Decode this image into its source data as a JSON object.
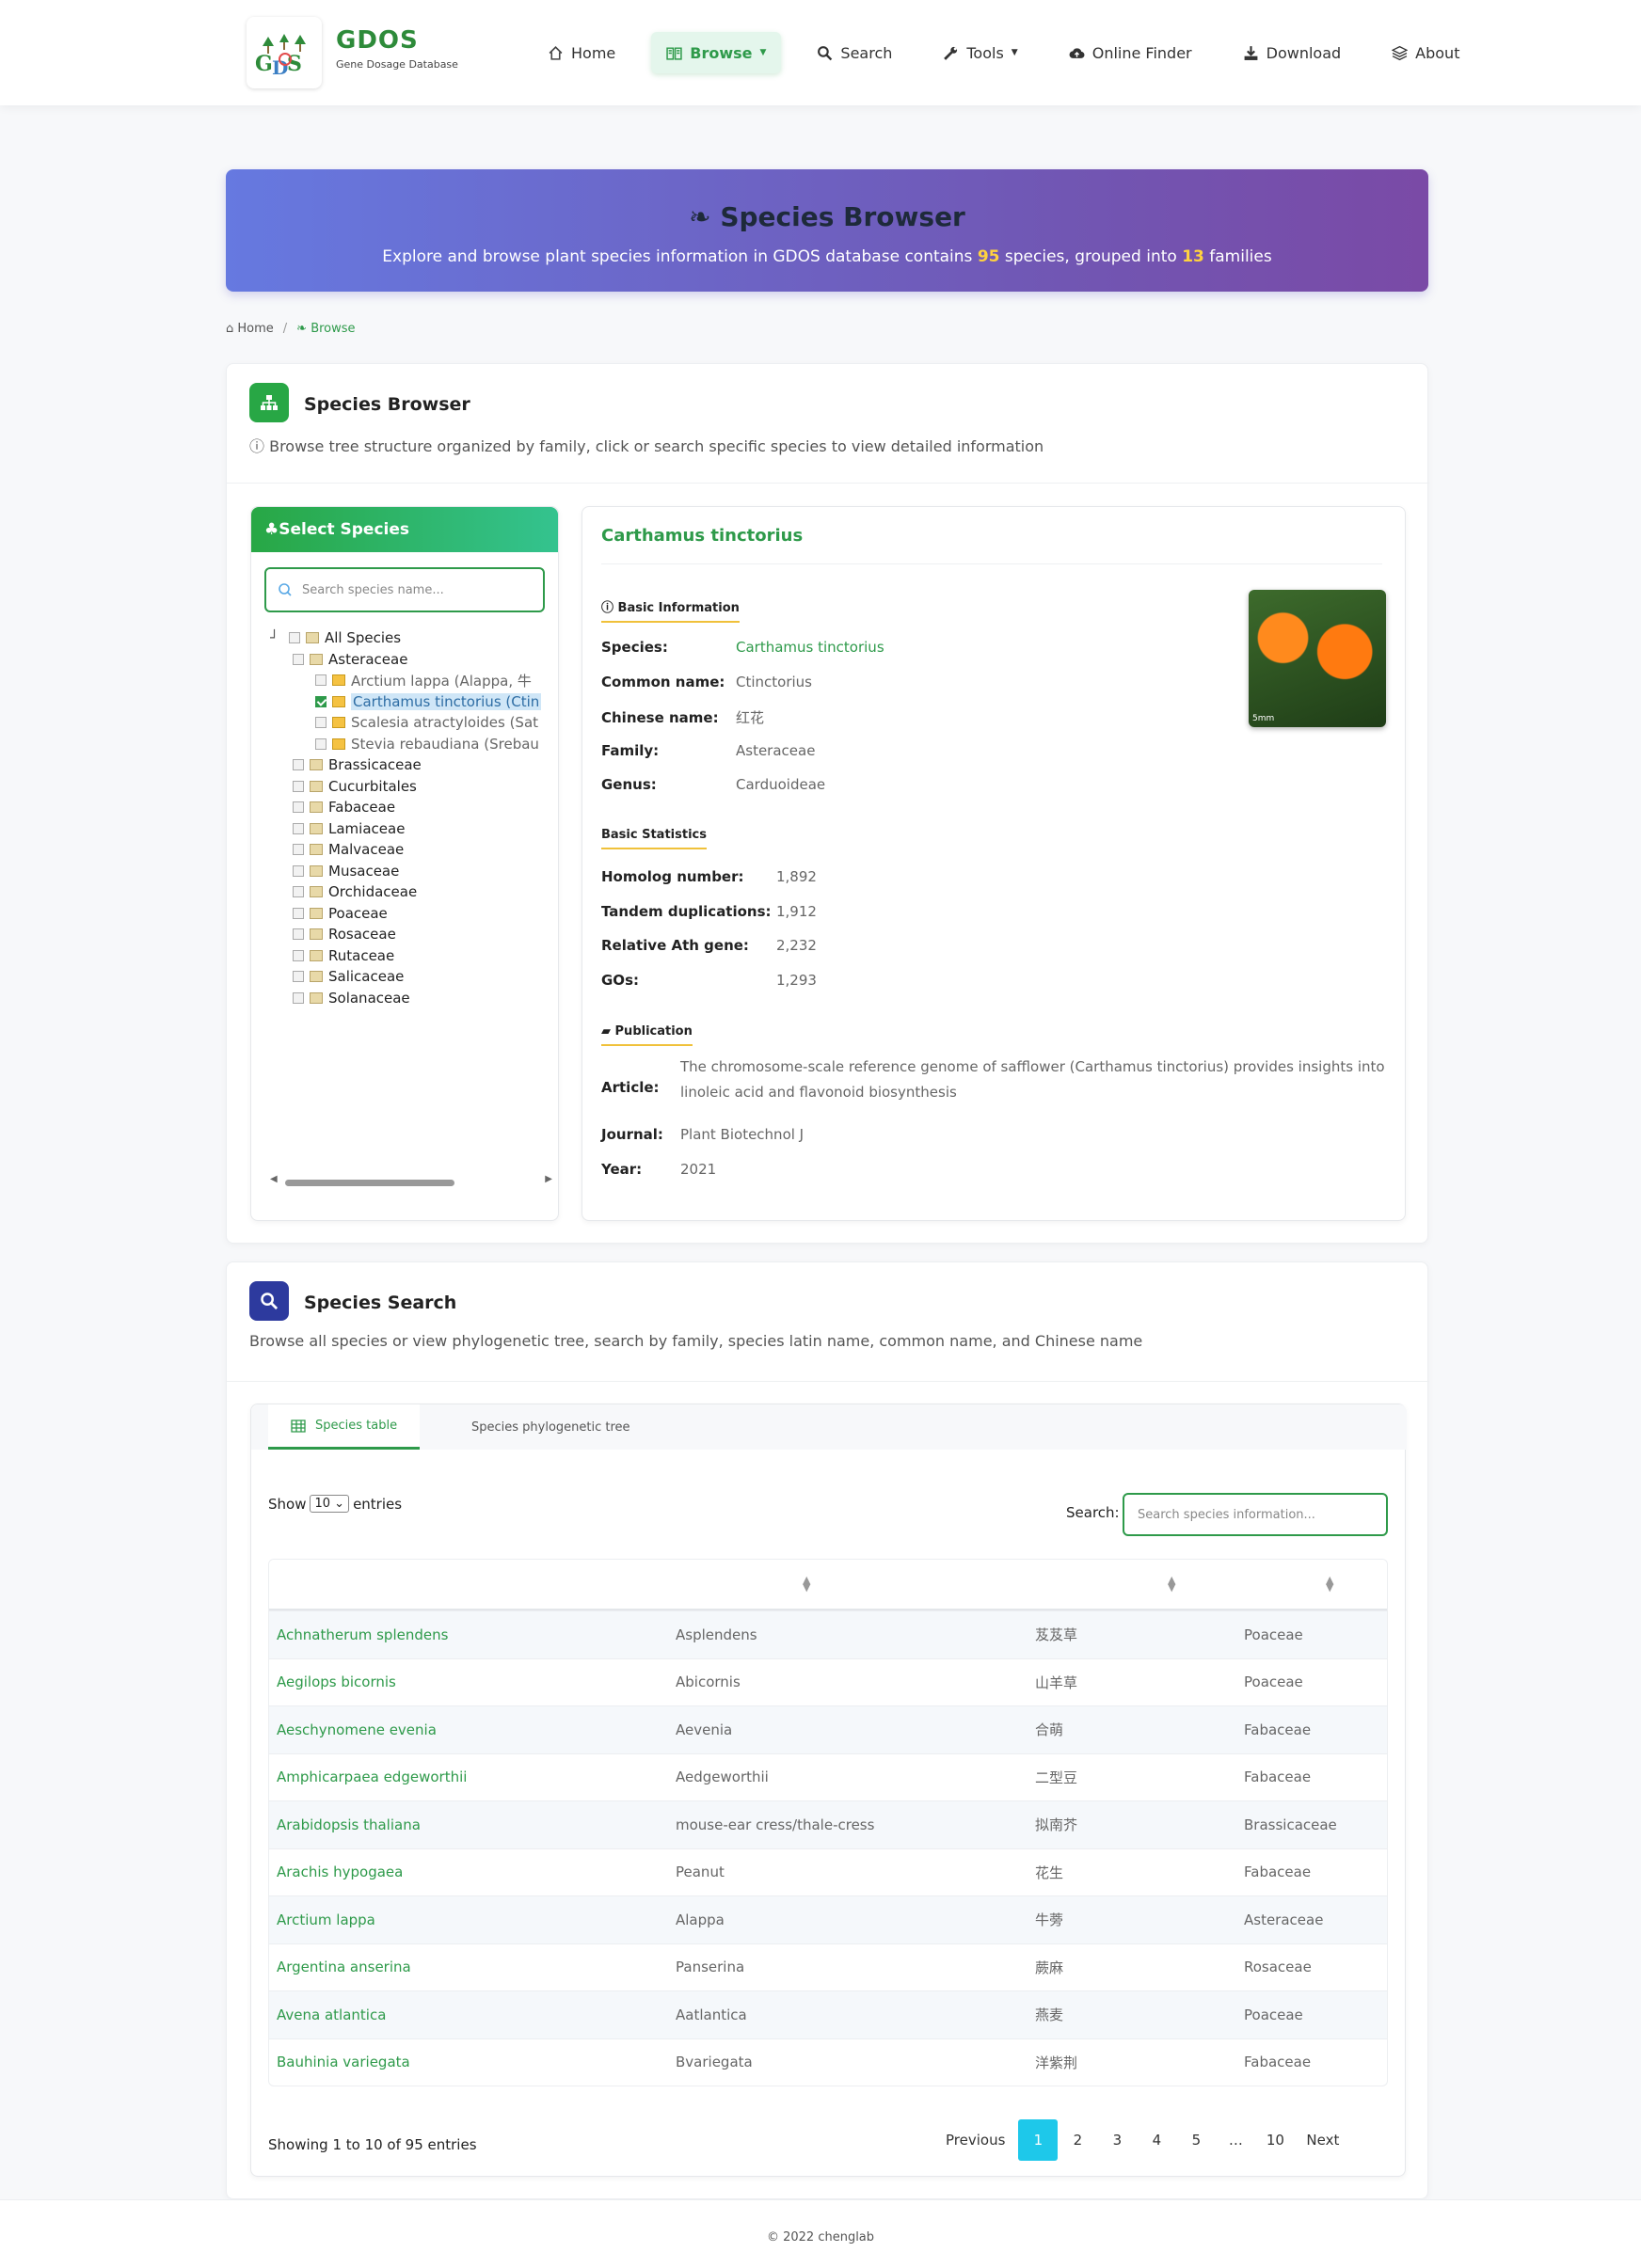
{
  "brand": {
    "name": "GDOS",
    "subtitle": "Gene Dosage Database"
  },
  "nav": [
    {
      "label": "Home",
      "icon": "home-icon"
    },
    {
      "label": "Browse",
      "icon": "book-icon",
      "active": true
    },
    {
      "label": "Search",
      "icon": "search-icon"
    },
    {
      "label": "Tools",
      "icon": "wrench-icon"
    },
    {
      "label": "Online Finder",
      "icon": "cloud-upload-icon"
    },
    {
      "label": "Download",
      "icon": "download-icon"
    },
    {
      "label": "About",
      "icon": "layers-icon"
    }
  ],
  "banner": {
    "title": "Species Browser",
    "text_pre": "Explore and browse plant species information in GDOS database contains ",
    "species_count": "95",
    "text_mid": " species, grouped into ",
    "family_count": "13",
    "text_post": " families"
  },
  "breadcrumb": {
    "home": "Home",
    "current": "Browse"
  },
  "browser": {
    "title": "Species Browser",
    "subtitle": "Browse tree structure organized by family, click or search specific species to view detailed information",
    "select_title": "Select Species",
    "search_placeholder": "Search species name...",
    "tree": {
      "root": "All Species",
      "expanded_family": "Asteraceae",
      "species": [
        {
          "label": "Arctium lappa (Alappa, 牛",
          "selected": false
        },
        {
          "label": "Carthamus tinctorius (Ctin",
          "selected": true
        },
        {
          "label": "Scalesia atractyloides (Sat",
          "selected": false
        },
        {
          "label": "Stevia rebaudiana (Srebau",
          "selected": false
        }
      ],
      "families": [
        "Brassicaceae",
        "Cucurbitales",
        "Fabaceae",
        "Lamiaceae",
        "Malvaceae",
        "Musaceae",
        "Orchidaceae",
        "Poaceae",
        "Rosaceae",
        "Rutaceae",
        "Salicaceae",
        "Solanaceae"
      ]
    }
  },
  "detail": {
    "title": "Carthamus tinctorius",
    "basic_label": "Basic Information",
    "basic": [
      {
        "k": "Species:",
        "v": "Carthamus tinctorius",
        "green": true
      },
      {
        "k": "Common name:",
        "v": "Ctinctorius"
      },
      {
        "k": "Chinese name:",
        "v": "红花"
      },
      {
        "k": "Family:",
        "v": "Asteraceae"
      },
      {
        "k": "Genus:",
        "v": "Carduoideae"
      }
    ],
    "stats_label": "Basic Statistics",
    "stats": [
      {
        "k": "Homolog number:",
        "v": "1,892"
      },
      {
        "k": "Tandem duplications:",
        "v": "1,912"
      },
      {
        "k": "Relative Ath gene:",
        "v": "2,232"
      },
      {
        "k": "GOs:",
        "v": "1,293"
      }
    ],
    "pub_label": "Publication",
    "article_k": "Article:",
    "article_v1": "The chromosome-scale reference genome of safflower (Carthamus tinctorius) provides insights into",
    "article_v2": "linoleic acid and flavonoid biosynthesis",
    "journal_k": "Journal:",
    "journal_v": "Plant Biotechnol J",
    "year_k": "Year:",
    "year_v": "2021",
    "photo_caption": "5mm"
  },
  "search_card": {
    "title": "Species Search",
    "subtitle": "Browse all species or view phylogenetic tree, search by family, species latin name, common name, and Chinese name",
    "tabs": [
      "Species table",
      "Species phylogenetic tree"
    ],
    "show_label": "Show",
    "entries_value": "10",
    "entries_label": "entries",
    "search_label": "Search:",
    "search_placeholder": "Search species information...",
    "rows": [
      [
        "Achnatherum splendens",
        "Asplendens",
        "芨芨草",
        "Poaceae"
      ],
      [
        "Aegilops bicornis",
        "Abicornis",
        "山羊草",
        "Poaceae"
      ],
      [
        "Aeschynomene evenia",
        "Aevenia",
        "合萌",
        "Fabaceae"
      ],
      [
        "Amphicarpaea edgeworthii",
        "Aedgeworthii",
        "二型豆",
        "Fabaceae"
      ],
      [
        "Arabidopsis thaliana",
        "mouse-ear cress/thale-cress",
        "拟南芥",
        "Brassicaceae"
      ],
      [
        "Arachis hypogaea",
        "Peanut",
        "花生",
        "Fabaceae"
      ],
      [
        "Arctium lappa",
        "Alappa",
        "牛蒡",
        "Asteraceae"
      ],
      [
        "Argentina anserina",
        "Panserina",
        "蕨麻",
        "Rosaceae"
      ],
      [
        "Avena atlantica",
        "Aatlantica",
        "燕麦",
        "Poaceae"
      ],
      [
        "Bauhinia variegata",
        "Bvariegata",
        "洋紫荆",
        "Fabaceae"
      ]
    ],
    "info": "Showing 1 to 10 of 95 entries",
    "pager": [
      "Previous",
      "1",
      "2",
      "3",
      "4",
      "5",
      "…",
      "10",
      "Next"
    ]
  },
  "footer": "© 2022 chenglab"
}
